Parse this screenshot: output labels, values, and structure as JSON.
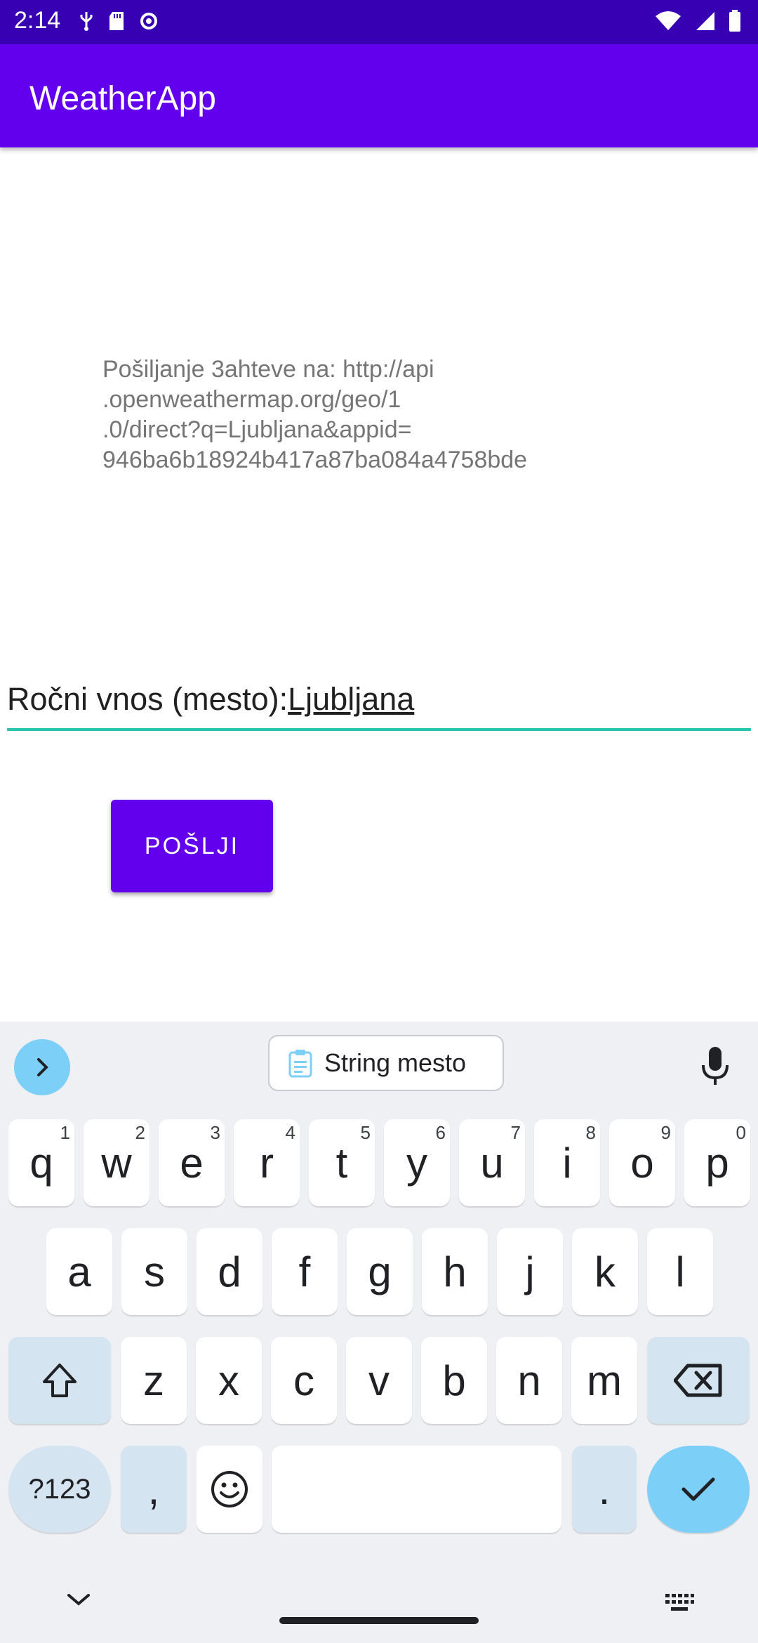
{
  "status": {
    "time": "2:14",
    "left_icons": [
      "usb-debug-icon",
      "sd-card-icon",
      "settings-icon"
    ],
    "right_icons": [
      "wifi-icon",
      "signal-icon",
      "battery-icon"
    ]
  },
  "app": {
    "title": "WeatherApp"
  },
  "main": {
    "request_text": "Pošiljanje 3ahteve na: http://api\n.openweathermap.org/geo/1\n.0/direct?q=Ljubljana&appid=\n946ba6b18924b417a87ba084a4758bde",
    "input_label": "Ročni vnos (mesto):",
    "input_value": "Ljubljana",
    "send_label": "POŠLJI"
  },
  "keyboard": {
    "suggestion": "String mesto",
    "rows": [
      [
        {
          "k": "q",
          "h": "1"
        },
        {
          "k": "w",
          "h": "2"
        },
        {
          "k": "e",
          "h": "3"
        },
        {
          "k": "r",
          "h": "4"
        },
        {
          "k": "t",
          "h": "5"
        },
        {
          "k": "y",
          "h": "6"
        },
        {
          "k": "u",
          "h": "7"
        },
        {
          "k": "i",
          "h": "8"
        },
        {
          "k": "o",
          "h": "9"
        },
        {
          "k": "p",
          "h": "0"
        }
      ],
      [
        {
          "k": "a"
        },
        {
          "k": "s"
        },
        {
          "k": "d"
        },
        {
          "k": "f"
        },
        {
          "k": "g"
        },
        {
          "k": "h"
        },
        {
          "k": "j"
        },
        {
          "k": "k"
        },
        {
          "k": "l"
        }
      ],
      [
        {
          "k": "z"
        },
        {
          "k": "x"
        },
        {
          "k": "c"
        },
        {
          "k": "v"
        },
        {
          "k": "b"
        },
        {
          "k": "n"
        },
        {
          "k": "m"
        }
      ]
    ],
    "symbols_label": "?123",
    "comma": ",",
    "period": "."
  },
  "colors": {
    "status_bar": "#3700b3",
    "app_bar": "#6200ee",
    "input_underline": "#26c6b0",
    "keyboard_bg": "#eff0f4",
    "key_accent": "#7ccff7",
    "key_special": "#d4e4f1"
  }
}
